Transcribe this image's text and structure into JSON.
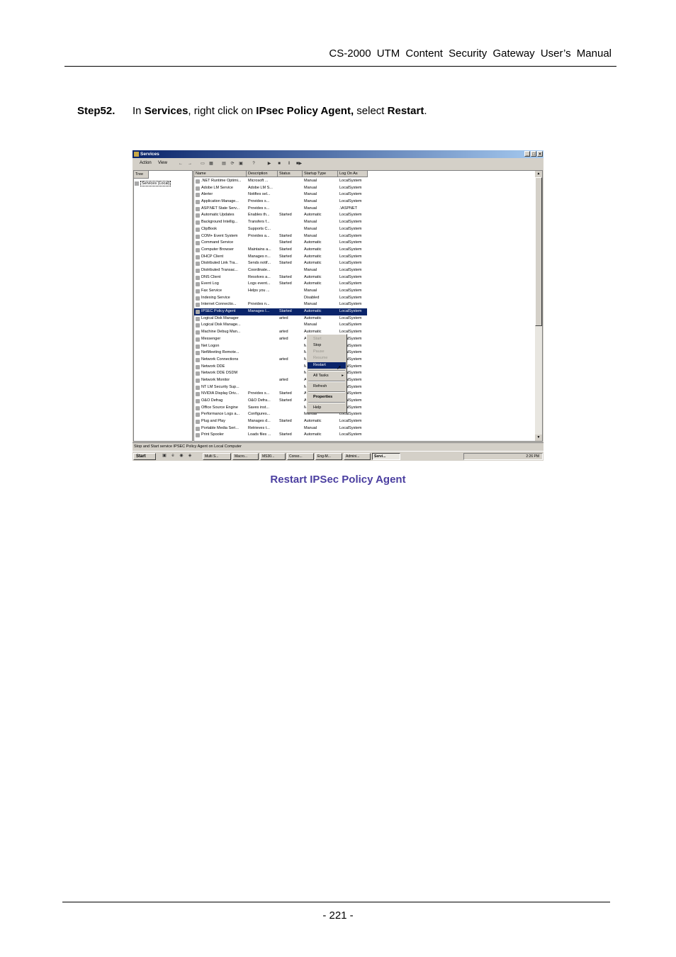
{
  "header": {
    "title": "CS-2000 UTM Content Security Gateway User’s Manual"
  },
  "step": {
    "label": "Step52.",
    "t1": "In ",
    "b1": "Services",
    "t2": ", right click on ",
    "b2": "IPsec Policy Agent,",
    "t3": " select ",
    "b3": "Restart",
    "t4": "."
  },
  "screenshot": {
    "title": "Services",
    "window_buttons": [
      "_",
      "̱₫",
      "×"
    ],
    "menu": [
      "Action",
      "View"
    ],
    "tree_header": "Tree",
    "tree_node": "Services (Local)",
    "columns": [
      "Name",
      "Description",
      "Status",
      "Startup Type",
      "Log On As"
    ],
    "rows": [
      [
        ".NET Runtime Optimi...",
        "Microsoft ...",
        "",
        "Manual",
        "LocalSystem"
      ],
      [
        "Adobe LM Service",
        "Adobe LM S...",
        "",
        "Manual",
        "LocalSystem"
      ],
      [
        "Alerter",
        "Notifies sel...",
        "",
        "Manual",
        "LocalSystem"
      ],
      [
        "Application Manage...",
        "Provides s...",
        "",
        "Manual",
        "LocalSystem"
      ],
      [
        "ASP.NET State Serv...",
        "Provides s...",
        "",
        "Manual",
        ".\\ASPNET"
      ],
      [
        "Automatic Updates",
        "Enables th...",
        "Started",
        "Automatic",
        "LocalSystem"
      ],
      [
        "Background Intellig...",
        "Transfers f...",
        "",
        "Manual",
        "LocalSystem"
      ],
      [
        "ClipBook",
        "Supports C...",
        "",
        "Manual",
        "LocalSystem"
      ],
      [
        "COM+ Event System",
        "Provides a...",
        "Started",
        "Manual",
        "LocalSystem"
      ],
      [
        "Command Service",
        "",
        "Started",
        "Automatic",
        "LocalSystem"
      ],
      [
        "Computer Browser",
        "Maintains a...",
        "Started",
        "Automatic",
        "LocalSystem"
      ],
      [
        "DHCP Client",
        "Manages n...",
        "Started",
        "Automatic",
        "LocalSystem"
      ],
      [
        "Distributed Link Tra...",
        "Sends notif...",
        "Started",
        "Automatic",
        "LocalSystem"
      ],
      [
        "Distributed Transac...",
        "Coordinate...",
        "",
        "Manual",
        "LocalSystem"
      ],
      [
        "DNS Client",
        "Resolves a...",
        "Started",
        "Automatic",
        "LocalSystem"
      ],
      [
        "Event Log",
        "Logs event...",
        "Started",
        "Automatic",
        "LocalSystem"
      ],
      [
        "Fax Service",
        "Helps you ...",
        "",
        "Manual",
        "LocalSystem"
      ],
      [
        "Indexing Service",
        "",
        "",
        "Disabled",
        "LocalSystem"
      ],
      [
        "Internet Connectio...",
        "Provides n...",
        "",
        "Manual",
        "LocalSystem"
      ],
      [
        "IPSEC Policy Agent",
        "Manages I...",
        "Started",
        "Automatic",
        "LocalSystem"
      ],
      [
        "Logical Disk Manager",
        "",
        "arted",
        "Automatic",
        "LocalSystem"
      ],
      [
        "Logical Disk Manage...",
        "",
        "",
        "Manual",
        "LocalSystem"
      ],
      [
        "Machine Debug Man...",
        "",
        "arted",
        "Automatic",
        "LocalSystem"
      ],
      [
        "Messenger",
        "",
        "arted",
        "Automatic",
        "LocalSystem"
      ],
      [
        "Net Logon",
        "",
        "",
        "Manual",
        "LocalSystem"
      ],
      [
        "NetMeeting Remote...",
        "",
        "",
        "Manual",
        "LocalSystem"
      ],
      [
        "Network Connections",
        "",
        "arted",
        "Manual",
        "LocalSystem"
      ],
      [
        "Network DDE",
        "",
        "",
        "Manual",
        "LocalSystem"
      ],
      [
        "Network DDE DSDM",
        "",
        "",
        "Manual",
        "LocalSystem"
      ],
      [
        "Network Monitor",
        "",
        "arted",
        "Automatic",
        "LocalSystem"
      ],
      [
        "NT LM Security Sup...",
        "",
        "",
        "Manual",
        "LocalSystem"
      ],
      [
        "NVIDIA Display Driv...",
        "Provides s...",
        "Started",
        "Automatic",
        "LocalSystem"
      ],
      [
        "O&O Defrag",
        "O&O Defra...",
        "Started",
        "Automatic",
        "LocalSystem"
      ],
      [
        "Office Source Engine",
        "Saves inst...",
        "",
        "Manual",
        "LocalSystem"
      ],
      [
        "Performance Logs a...",
        "Configures...",
        "",
        "Manual",
        "LocalSystem"
      ],
      [
        "Plug and Play",
        "Manages d...",
        "Started",
        "Automatic",
        "LocalSystem"
      ],
      [
        "Portable Media Seri...",
        "Retrieves t...",
        "",
        "Manual",
        "LocalSystem"
      ],
      [
        "Print Spooler",
        "Loads files ...",
        "Started",
        "Automatic",
        "LocalSystem"
      ]
    ],
    "context_menu": [
      "Start",
      "Stop",
      "Pause",
      "Resume",
      "Restart",
      "All Tasks",
      "Refresh",
      "Properties",
      "Help"
    ],
    "status_text": "Stop and Start service IPSEC Policy Agent on Local Computer",
    "start_label": "Start",
    "tasks": [
      "Multi S...",
      "Macro...",
      "MS30...",
      "Conso...",
      "Eng-M...",
      "Admini...",
      "Servi..."
    ],
    "clock": "2:26 PM"
  },
  "caption": "Restart IPSec Policy Agent",
  "page_number": "- 221 -"
}
